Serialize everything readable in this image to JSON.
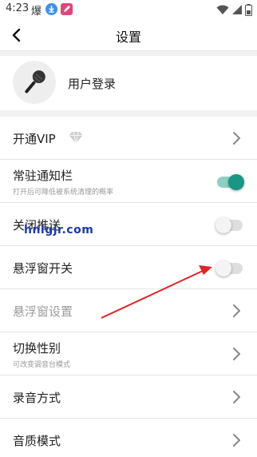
{
  "status_bar": {
    "time": "4:23",
    "app_glyph": "爆",
    "icons": [
      "download-icon",
      "edit-icon",
      "wifi-icon",
      "signal-icon",
      "battery-icon"
    ]
  },
  "header": {
    "title": "设置",
    "back_icon": "back-arrow-icon"
  },
  "user": {
    "login_label": "用户登录",
    "avatar_icon": "microphone-icon"
  },
  "settings": [
    {
      "label": "开通VIP",
      "control": "chevron",
      "badge_icon": "diamond-icon"
    },
    {
      "label": "常驻通知栏",
      "sublabel": "打开后可降低被系统清理的概率",
      "control": "toggle",
      "state": "on"
    },
    {
      "label": "关闭推送",
      "control": "toggle",
      "state": "off"
    },
    {
      "label": "悬浮窗开关",
      "control": "toggle",
      "state": "off"
    },
    {
      "label": "悬浮窗设置",
      "control": "chevron",
      "disabled": true
    },
    {
      "label": "切换性别",
      "sublabel": "可改变调音台模式",
      "control": "chevron"
    },
    {
      "label": "录音方式",
      "control": "chevron"
    },
    {
      "label": "音质模式",
      "control": "chevron"
    }
  ],
  "watermark": "hnlgjr.com",
  "colors": {
    "accent": "#179784",
    "arrow": "#e02424"
  }
}
